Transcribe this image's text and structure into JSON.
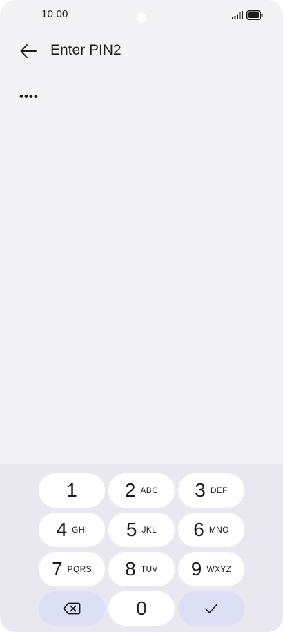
{
  "status_bar": {
    "time": "10:00"
  },
  "header": {
    "title": "Enter PIN2"
  },
  "pin_field": {
    "value": "••••"
  },
  "keypad": {
    "keys": [
      {
        "digit": "1",
        "letters": ""
      },
      {
        "digit": "2",
        "letters": "ABC"
      },
      {
        "digit": "3",
        "letters": "DEF"
      },
      {
        "digit": "4",
        "letters": "GHI"
      },
      {
        "digit": "5",
        "letters": "JKL"
      },
      {
        "digit": "6",
        "letters": "MNO"
      },
      {
        "digit": "7",
        "letters": "PQRS"
      },
      {
        "digit": "8",
        "letters": "TUV"
      },
      {
        "digit": "9",
        "letters": "WXYZ"
      },
      {
        "digit": "0",
        "letters": ""
      }
    ]
  },
  "colors": {
    "background": "#f3f3f6",
    "keypad_background": "#e9e8f1",
    "accent_key": "#dcdff5",
    "key": "#ffffff",
    "text": "#1c1c1e"
  },
  "icons": {
    "back": "arrow-left-icon",
    "backspace": "backspace-icon",
    "confirm": "checkmark-icon",
    "signal": "signal-icon",
    "battery": "battery-icon"
  }
}
